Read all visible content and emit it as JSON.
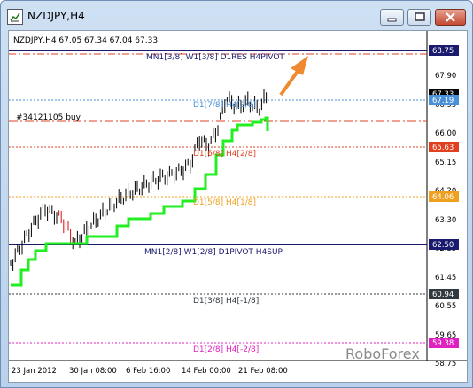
{
  "window": {
    "title": "NZDJPY,H4",
    "controls": [
      "minimize",
      "restore",
      "close"
    ]
  },
  "chart": {
    "info_line": "NZDJPY,H4  67.05 67.34 67.04 67.33",
    "order_label": "#34121105 buy",
    "watermark": "RoboForex",
    "levels": [
      {
        "label": "MN1[3/8] W1[3/8] D1RES H4PIVOT",
        "price_tag": "68.75",
        "color": "#1a1a6e"
      },
      {
        "label": "D1[7/8] H4[3/8]",
        "price_tag": "67.19",
        "color": "#4a90d9"
      },
      {
        "label": "D1[6/8] H4[2/8]",
        "price_tag": "65.63",
        "color": "#e04020"
      },
      {
        "label": "D1[5/8] H4[1/8]",
        "price_tag": "64.06",
        "color": "#f0a020"
      },
      {
        "label": "MN1[2/8] W1[2/8] D1PIVOT H4SUP",
        "price_tag": "62.50",
        "color": "#1a1a6e"
      },
      {
        "label": "D1[3/8] H4[-1/8]",
        "price_tag": "60.94",
        "color": "#303a40"
      },
      {
        "label": "D1[2/8] H4[-2/8]",
        "price_tag": "59.38",
        "color": "#e020c0"
      }
    ],
    "current_price_tag": "67.33",
    "y_ticks": [
      "67.90",
      "66.95",
      "66.00",
      "65.15",
      "64.20",
      "63.30",
      "62.35",
      "61.45",
      "60.55",
      "59.65",
      "58.75"
    ],
    "x_ticks": [
      "23 Jan 2012",
      "30 Jan 08:00",
      "6 Feb 16:00",
      "14 Feb 00:00",
      "21 Feb 08:00"
    ]
  }
}
